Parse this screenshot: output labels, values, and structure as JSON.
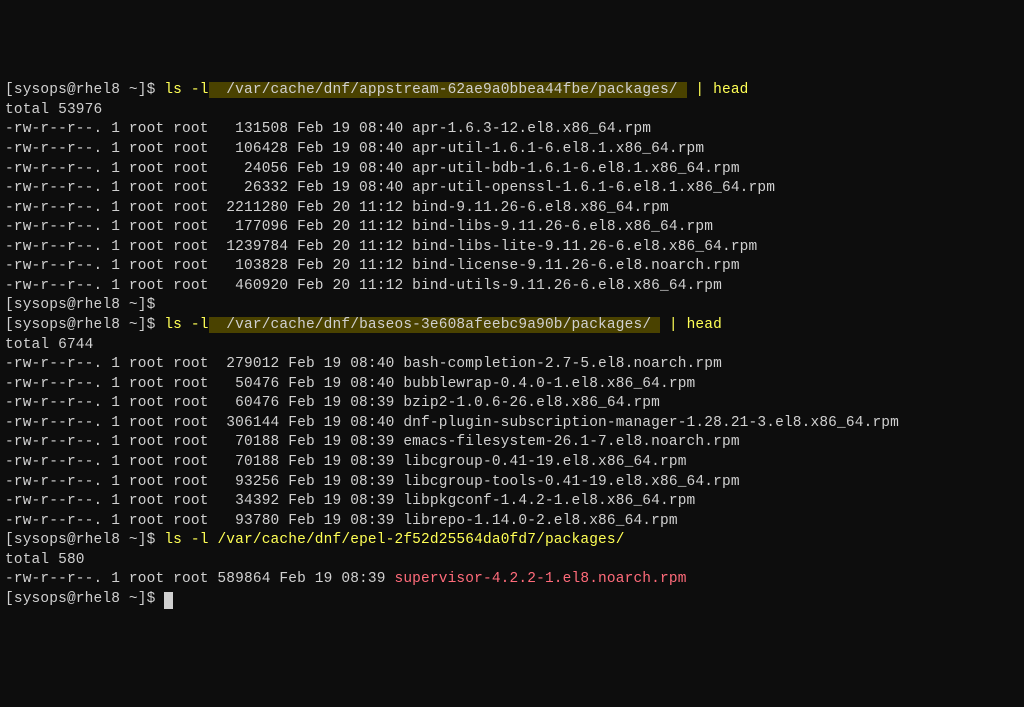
{
  "prompt1": {
    "user": "[sysops@rhel8 ~]$ ",
    "cmd": "ls -l",
    "path": "  /var/cache/dnf/appstream-62ae9a0bbea44fbe/packages/ ",
    "suffix": " | head"
  },
  "total1": "total 53976",
  "listing1": [
    "-rw-r--r--. 1 root root   131508 Feb 19 08:40 apr-1.6.3-12.el8.x86_64.rpm",
    "-rw-r--r--. 1 root root   106428 Feb 19 08:40 apr-util-1.6.1-6.el8.1.x86_64.rpm",
    "-rw-r--r--. 1 root root    24056 Feb 19 08:40 apr-util-bdb-1.6.1-6.el8.1.x86_64.rpm",
    "-rw-r--r--. 1 root root    26332 Feb 19 08:40 apr-util-openssl-1.6.1-6.el8.1.x86_64.rpm",
    "-rw-r--r--. 1 root root  2211280 Feb 20 11:12 bind-9.11.26-6.el8.x86_64.rpm",
    "-rw-r--r--. 1 root root   177096 Feb 20 11:12 bind-libs-9.11.26-6.el8.x86_64.rpm",
    "-rw-r--r--. 1 root root  1239784 Feb 20 11:12 bind-libs-lite-9.11.26-6.el8.x86_64.rpm",
    "-rw-r--r--. 1 root root   103828 Feb 20 11:12 bind-license-9.11.26-6.el8.noarch.rpm",
    "-rw-r--r--. 1 root root   460920 Feb 20 11:12 bind-utils-9.11.26-6.el8.x86_64.rpm"
  ],
  "prompt2_empty": "[sysops@rhel8 ~]$",
  "prompt2": {
    "user": "[sysops@rhel8 ~]$ ",
    "cmd": "ls -l",
    "path": "  /var/cache/dnf/baseos-3e608afeebc9a90b/packages/ ",
    "suffix": " | head"
  },
  "total2": "total 6744",
  "listing2": [
    "-rw-r--r--. 1 root root  279012 Feb 19 08:40 bash-completion-2.7-5.el8.noarch.rpm",
    "-rw-r--r--. 1 root root   50476 Feb 19 08:40 bubblewrap-0.4.0-1.el8.x86_64.rpm",
    "-rw-r--r--. 1 root root   60476 Feb 19 08:39 bzip2-1.0.6-26.el8.x86_64.rpm",
    "-rw-r--r--. 1 root root  306144 Feb 19 08:40 dnf-plugin-subscription-manager-1.28.21-3.el8.x86_64.rpm",
    "-rw-r--r--. 1 root root   70188 Feb 19 08:39 emacs-filesystem-26.1-7.el8.noarch.rpm",
    "-rw-r--r--. 1 root root   70188 Feb 19 08:39 libcgroup-0.41-19.el8.x86_64.rpm",
    "-rw-r--r--. 1 root root   93256 Feb 19 08:39 libcgroup-tools-0.41-19.el8.x86_64.rpm",
    "-rw-r--r--. 1 root root   34392 Feb 19 08:39 libpkgconf-1.4.2-1.el8.x86_64.rpm",
    "-rw-r--r--. 1 root root   93780 Feb 19 08:39 librepo-1.14.0-2.el8.x86_64.rpm"
  ],
  "prompt3": {
    "user": "[sysops@rhel8 ~]$ ",
    "cmd": "ls -l",
    "path": " /var/cache/dnf/epel-2f52d25564da0fd7/packages/"
  },
  "total3": "total 580",
  "listing3_prefix": "-rw-r--r--. 1 root root 589864 Feb 19 08:39 ",
  "listing3_file": "supervisor-4.2.2-1.el8.noarch.rpm",
  "prompt4": "[sysops@rhel8 ~]$ "
}
